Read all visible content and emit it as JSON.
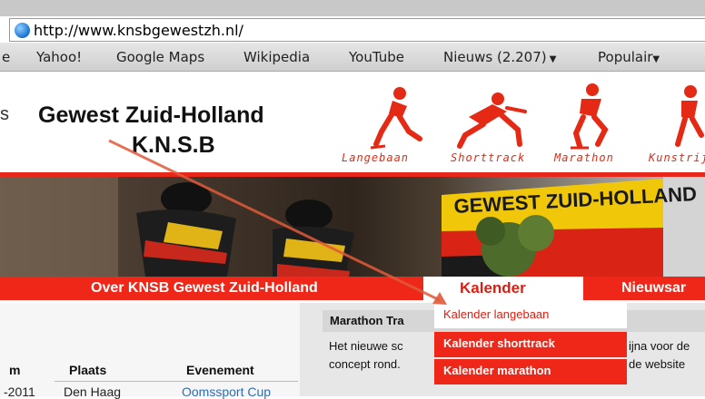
{
  "browser": {
    "url": "http://www.knsbgewestzh.nl/",
    "bookmarks": [
      "e",
      "Yahoo!",
      "Google Maps",
      "Wikipedia",
      "YouTube",
      "Nieuws (2.207)",
      "Populair"
    ]
  },
  "site": {
    "title": "Gewest Zuid-Holland",
    "subtitle": "K.N.S.B",
    "left_fragment": "s",
    "sports": [
      "Langebaan",
      "Shorttrack",
      "Marathon",
      "Kunstrij"
    ],
    "banner_text": "GEWEST ZUID-HOLLAND"
  },
  "nav": {
    "items": [
      "Over KNSB Gewest Zuid-Holland",
      "Kalender",
      "Nieuwsar"
    ],
    "dropdown": [
      "Kalender langebaan",
      "Kalender shorttrack",
      "Kalender marathon"
    ]
  },
  "content": {
    "marathon_heading": "Marathon Tra",
    "text_line1_left": "Het nieuwe sc",
    "text_line1_right": "ijna voor de",
    "text_line2_left": "concept rond.",
    "text_line2_right": "de website",
    "table": {
      "headers": [
        "m",
        "Plaats",
        "Evenement"
      ],
      "row": [
        "-2011",
        "Den Haag",
        "Oomssport Cup"
      ]
    }
  },
  "colors": {
    "accent": "#ee2718",
    "dropdown_bg": "#ee2718"
  }
}
